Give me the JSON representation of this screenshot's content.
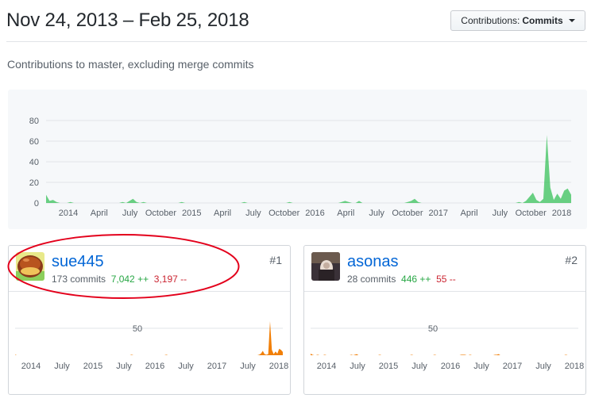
{
  "header": {
    "date_range": "Nov 24, 2013 – Feb 25, 2018",
    "contributions_prefix": "Contributions:",
    "contributions_value": "Commits",
    "subtitle": "Contributions to master, excluding merge commits"
  },
  "chart_data": [
    {
      "type": "area",
      "title": "",
      "ylim": [
        0,
        80
      ],
      "y_ticks": [
        "0",
        "20",
        "40",
        "60",
        "80"
      ],
      "x_tick_labels": [
        "2014",
        "April",
        "July",
        "October",
        "2015",
        "April",
        "July",
        "October",
        "2016",
        "April",
        "July",
        "October",
        "2017",
        "April",
        "July",
        "October",
        "2018"
      ],
      "color": "#2cbe4e",
      "grid": true,
      "series": [
        {
          "values": [
            8,
            2,
            3,
            1,
            0,
            0,
            0,
            1,
            0,
            0,
            0,
            0,
            0,
            0,
            0,
            0,
            0,
            0,
            0,
            0,
            0,
            0,
            1,
            0,
            2,
            4,
            1,
            0,
            1,
            0,
            0,
            0,
            0,
            0,
            0,
            0,
            0,
            0,
            0,
            1,
            0,
            0,
            0,
            0,
            0,
            0,
            0,
            0,
            0,
            0,
            0,
            0,
            0,
            0,
            0,
            0,
            0,
            1,
            0,
            0,
            0,
            0,
            0,
            0,
            0,
            0,
            0,
            0,
            0,
            0,
            1,
            0,
            0,
            0,
            0,
            0,
            0,
            0,
            0,
            0,
            0,
            0,
            0,
            0,
            0,
            1,
            2,
            1,
            0,
            0,
            2,
            0,
            0,
            0,
            0,
            0,
            0,
            0,
            0,
            0,
            0,
            0,
            0,
            0,
            1,
            2,
            4,
            1,
            0,
            0,
            0,
            0,
            0,
            0,
            0,
            0,
            0,
            0,
            0,
            0,
            0,
            0,
            0,
            0,
            0,
            0,
            0,
            0,
            0,
            0,
            0,
            0,
            0,
            0,
            0,
            0,
            1,
            0,
            2,
            6,
            10,
            3,
            1,
            4,
            66,
            15,
            3,
            9,
            4,
            12,
            14,
            8
          ]
        }
      ]
    }
  ],
  "contributors": [
    {
      "username": "sue445",
      "commits": "173 commits",
      "additions": "7,042 ++",
      "deletions": "3,197 --",
      "rank": "#1",
      "y_tick": "50",
      "x_tick_labels": [
        "2014",
        "July",
        "2015",
        "July",
        "2016",
        "July",
        "2017",
        "July",
        "2018"
      ],
      "color": "#f17f07",
      "values": [
        1,
        0,
        0,
        0,
        0,
        0,
        0,
        0,
        0,
        0,
        0,
        0,
        0,
        0,
        0,
        0,
        0,
        0,
        0,
        0,
        0,
        0,
        0,
        0,
        0,
        0,
        0,
        0,
        0,
        0,
        0,
        0,
        0,
        0,
        0,
        0,
        0,
        0,
        0,
        0,
        0,
        0,
        0,
        0,
        0,
        0,
        0,
        0,
        0,
        0,
        0,
        0,
        0,
        0,
        0,
        0,
        0,
        0,
        0,
        0,
        0,
        0,
        0,
        0,
        1,
        0,
        0,
        0,
        0,
        0,
        0,
        0,
        0,
        0,
        0,
        0,
        0,
        0,
        0,
        0,
        0,
        0,
        0,
        1,
        0,
        0,
        0,
        0,
        0,
        0,
        0,
        0,
        0,
        0,
        0,
        0,
        0,
        0,
        0,
        0,
        0,
        0,
        0,
        0,
        0,
        0,
        0,
        0,
        0,
        0,
        0,
        0,
        0,
        0,
        0,
        0,
        0,
        0,
        0,
        0,
        0,
        0,
        0,
        0,
        0,
        0,
        0,
        0,
        0,
        0,
        0,
        0,
        0,
        0,
        1,
        3,
        8,
        2,
        1,
        2,
        63,
        10,
        2,
        7,
        3,
        12,
        10,
        6
      ]
    },
    {
      "username": "asonas",
      "commits": "28 commits",
      "additions": "446 ++",
      "deletions": "55 --",
      "rank": "#2",
      "y_tick": "50",
      "x_tick_labels": [
        "2014",
        "July",
        "2015",
        "July",
        "2016",
        "July",
        "2017",
        "July",
        "2018"
      ],
      "color": "#f17f07",
      "values": [
        3,
        1,
        0,
        0,
        1,
        0,
        0,
        0,
        1,
        0,
        0,
        0,
        0,
        0,
        0,
        0,
        0,
        0,
        0,
        0,
        0,
        0,
        0,
        1,
        0,
        1,
        2,
        0,
        0,
        0,
        0,
        0,
        0,
        0,
        0,
        0,
        0,
        0,
        0,
        1,
        0,
        0,
        0,
        0,
        0,
        0,
        0,
        0,
        0,
        0,
        0,
        0,
        0,
        0,
        0,
        0,
        0,
        1,
        0,
        0,
        0,
        0,
        0,
        0,
        0,
        0,
        0,
        0,
        0,
        0,
        1,
        0,
        0,
        0,
        0,
        0,
        0,
        0,
        0,
        0,
        0,
        0,
        0,
        0,
        0,
        1,
        1,
        1,
        0,
        0,
        1,
        0,
        0,
        0,
        0,
        0,
        0,
        0,
        0,
        0,
        0,
        0,
        0,
        0,
        1,
        1,
        2,
        0,
        0,
        0,
        0,
        0,
        0,
        0,
        0,
        0,
        0,
        0,
        0,
        0,
        0,
        0,
        0,
        0,
        0,
        0,
        0,
        0,
        0,
        0,
        0,
        0,
        0,
        0,
        0,
        0,
        0,
        0,
        0,
        0,
        0,
        0,
        0,
        0,
        1,
        0,
        0,
        0,
        0,
        0,
        0,
        0
      ]
    }
  ],
  "colors": {
    "link": "#0366d6",
    "additions": "#28a745",
    "deletions": "#cb2431",
    "highlight": "#e3001b"
  }
}
